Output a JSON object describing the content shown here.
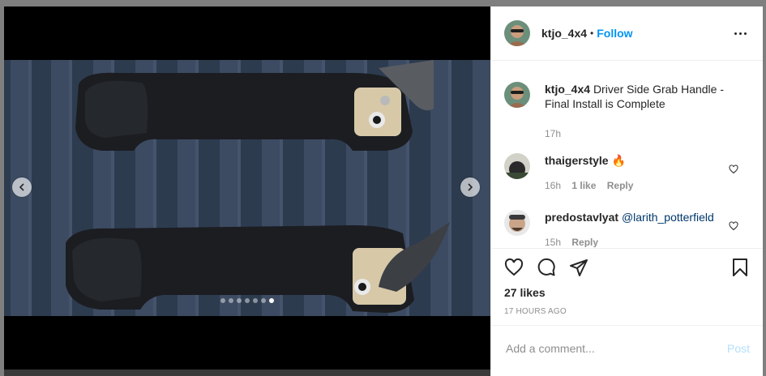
{
  "post": {
    "username": "ktjo_4x4",
    "dot": "•",
    "follow_label": "Follow",
    "caption_user": "ktjo_4x4",
    "caption_text": "Driver Side Grab Handle - Final Install is Complete",
    "caption_time": "17h",
    "likes": "27 likes",
    "timestamp": "17 HOURS AGO",
    "comment_placeholder": "Add a comment...",
    "post_label": "Post",
    "carousel": {
      "count": 7,
      "active_index": 6
    }
  },
  "comments": [
    {
      "user": "thaigerstyle",
      "text": "🔥",
      "time": "16h",
      "likes": "1 like",
      "reply": "Reply"
    },
    {
      "user": "predostavlyat",
      "text": "@larith_potterfield",
      "time": "15h",
      "reply": "Reply"
    }
  ],
  "colors": {
    "accent": "#0095f6",
    "text": "#262626",
    "muted": "#8e8e8e",
    "post_disabled": "#b2dffc"
  }
}
